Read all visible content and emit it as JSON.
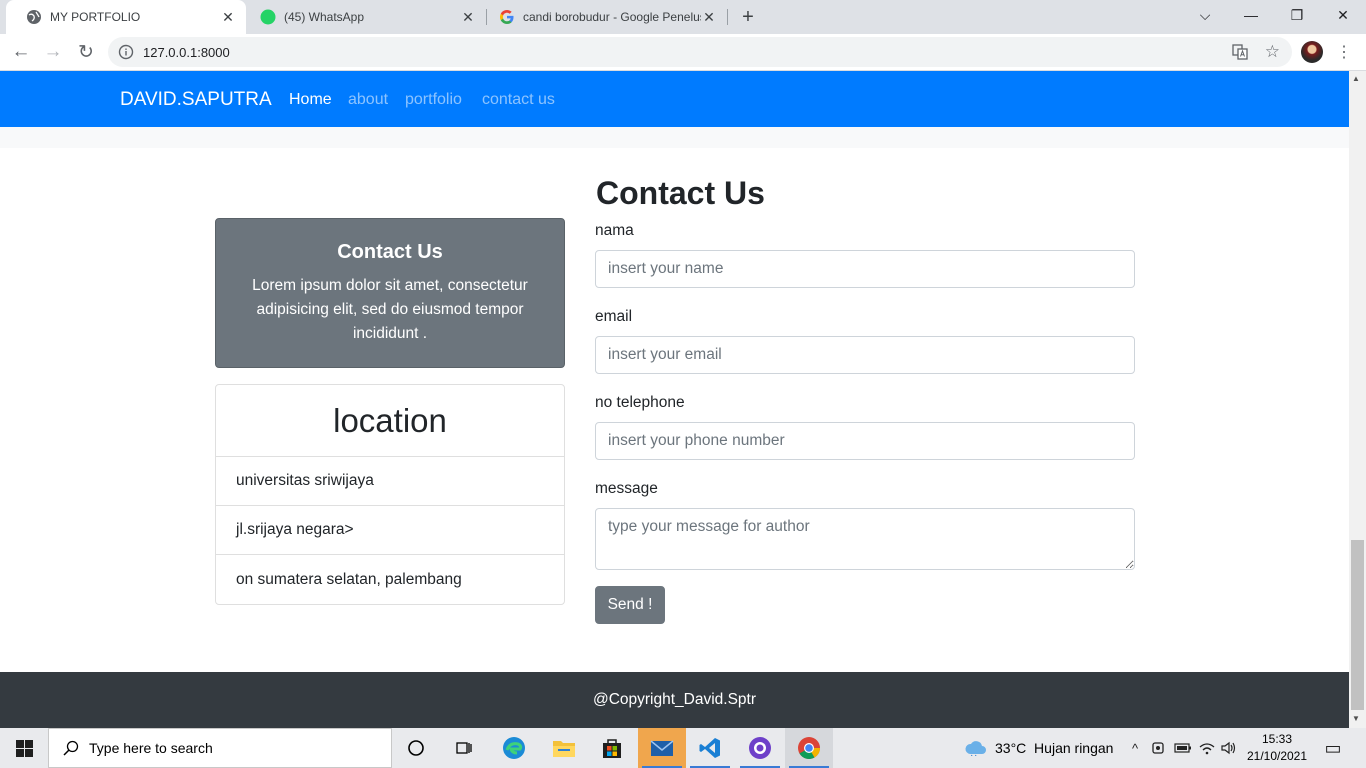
{
  "browser": {
    "tabs": [
      {
        "title": "MY PORTFOLIO",
        "active": true
      },
      {
        "title": "(45) WhatsApp",
        "badge": "45",
        "active": false
      },
      {
        "title": "candi borobudur - Google Penelusuran",
        "active": false
      }
    ],
    "url": "127.0.0.1:8000",
    "new_tab_icon": "plus-icon",
    "close_glyph": "✕",
    "plus_glyph": "+",
    "dropdown_glyph": "⌵",
    "minimize_glyph": "—",
    "restore_glyph": "❐",
    "window_close_glyph": "✕",
    "back_glyph": "←",
    "forward_glyph": "→",
    "reload_glyph": "↻",
    "star_glyph": "☆",
    "menu_glyph": "⋮"
  },
  "nav": {
    "brand": "DAVID.SAPUTRA",
    "links": [
      "Home",
      "about",
      "portfolio",
      "contact us"
    ],
    "active_link": "Home",
    "color": "#007bff"
  },
  "contact_card": {
    "title": "Contact Us",
    "text": "Lorem ipsum dolor sit amet, consectetur adipisicing elit, sed do eiusmod tempor incididunt ."
  },
  "location": {
    "title": "location",
    "items": [
      "universitas sriwijaya",
      "jl.srijaya negara>",
      "on sumatera selatan, palembang"
    ]
  },
  "form": {
    "title": "Contact Us",
    "name_label": "nama",
    "name_placeholder": "insert your name",
    "email_label": "email",
    "email_placeholder": "insert your email",
    "phone_label": "no telephone",
    "phone_placeholder": "insert your phone number",
    "message_label": "message",
    "message_placeholder": "type your message for author",
    "submit_label": "Send !"
  },
  "footer": {
    "text": "@Copyright_David.Sptr"
  },
  "taskbar": {
    "search_placeholder": "Type here to search",
    "weather": "33°C  Hujan ringan",
    "time": "15:33",
    "date": "21/10/2021",
    "up_glyph": "^",
    "notification_glyph": "▭"
  }
}
